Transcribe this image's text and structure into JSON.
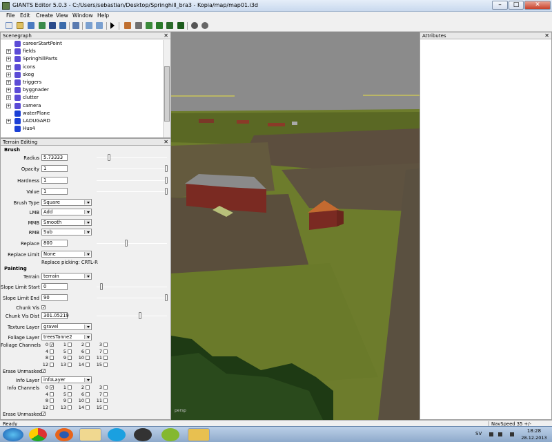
{
  "window": {
    "title": "GIANTS Editor 5.0.3 - C:/Users/sebastian/Desktop/Springhill_bra3 - Kopia/map/map01.i3d",
    "minimize": "–",
    "maximize": "□",
    "close": "✕"
  },
  "menu": [
    "File",
    "Edit",
    "Create",
    "View",
    "Window",
    "Help"
  ],
  "scenegraph": {
    "title": "Scenegraph",
    "close": "✕",
    "items": [
      {
        "label": "careerStartPoint",
        "icon": "transform-node-icon",
        "expander": false,
        "color": "#5b4bd6"
      },
      {
        "label": "fields",
        "icon": "transform-node-icon",
        "expander": true,
        "color": "#5b4bd6"
      },
      {
        "label": "SpringhillParts",
        "icon": "transform-node-icon",
        "expander": true,
        "color": "#5b4bd6"
      },
      {
        "label": "icons",
        "icon": "transform-node-icon",
        "expander": true,
        "color": "#5b4bd6"
      },
      {
        "label": "skog",
        "icon": "transform-node-icon",
        "expander": true,
        "color": "#5b4bd6"
      },
      {
        "label": "triggers",
        "icon": "transform-node-icon",
        "expander": true,
        "color": "#5b4bd6"
      },
      {
        "label": "byggnader",
        "icon": "transform-node-icon",
        "expander": true,
        "color": "#5b4bd6"
      },
      {
        "label": "clutter",
        "icon": "transform-node-icon",
        "expander": true,
        "color": "#5b4bd6"
      },
      {
        "label": "camera",
        "icon": "camera-node-icon",
        "expander": true,
        "color": "#5b4bd6"
      },
      {
        "label": "waterPlane",
        "icon": "shape-node-icon",
        "expander": false,
        "color": "#1a3fd6"
      },
      {
        "label": "LADUGARD",
        "icon": "shape-node-icon",
        "expander": true,
        "color": "#1a3fd6"
      },
      {
        "label": "Hus4",
        "icon": "shape-node-icon",
        "expander": false,
        "color": "#1a3fd6"
      }
    ]
  },
  "terrain": {
    "title": "Terrain Editing",
    "close": "✕",
    "brush_header": "Brush",
    "radius_label": "Radius",
    "radius_value": "5.73333",
    "opacity_label": "Opacity",
    "opacity_value": "1",
    "hardness_label": "Hardness",
    "hardness_value": "1",
    "value_label": "Value",
    "value_value": "1",
    "brush_type_label": "Brush Type",
    "brush_type_value": "Square",
    "lmb_label": "LMB",
    "lmb_value": "Add",
    "mmb_label": "MMB",
    "mmb_value": "Smooth",
    "rmb_label": "RMB",
    "rmb_value": "Sub",
    "replace_label": "Replace",
    "replace_value": "800",
    "replace_limit_label": "Replace Limit",
    "replace_limit_value": "None",
    "replace_picking": "Replace picking: CRTL-R",
    "painting_header": "Painting",
    "terrain_label": "Terrain",
    "terrain_value": "terrain",
    "slope_start_label": "Slope Limit Start",
    "slope_start_value": "0",
    "slope_end_label": "Slope Limit End",
    "slope_end_value": "90",
    "chunk_vis_label": "Chunk Vis",
    "chunk_vis_dist_label": "Chunk Vis Dist",
    "chunk_vis_dist_value": "301.05219",
    "texture_layer_label": "Texture Layer",
    "texture_layer_value": "gravel",
    "foliage_layer_label": "Foliage Layer",
    "foliage_layer_value": "treesTanne2",
    "foliage_channels_label": "Foliage Channels",
    "erase_unmasked_label": "Erase Unmasked",
    "info_layer_label": "Info Layer",
    "info_layer_value": "infoLayer",
    "info_channels_label": "Info Channels",
    "erase_unmasked2_label": "Erase Unmasked",
    "channel_numbers": [
      "0",
      "1",
      "2",
      "3",
      "4",
      "5",
      "6",
      "7",
      "8",
      "9",
      "10",
      "11",
      "12",
      "13",
      "14",
      "15"
    ]
  },
  "attributes": {
    "title": "Attributes",
    "close": "✕"
  },
  "viewport": {
    "corner_label": "persp"
  },
  "status": {
    "left": "Ready",
    "right": "NavSpeed 35 +/-"
  },
  "taskbar": {
    "lang": "SV",
    "time": "18:28",
    "date": "28.12.2013",
    "apps": [
      "windows-start-icon",
      "chrome-icon",
      "firefox-icon",
      "explorer-icon",
      "skype-icon",
      "steam-icon",
      "spotify-icon",
      "giants-editor-icon"
    ]
  },
  "colors": {
    "accent": "#3a6ea5",
    "grass": "#6b7a2a",
    "sky": "#8b8b8b"
  }
}
